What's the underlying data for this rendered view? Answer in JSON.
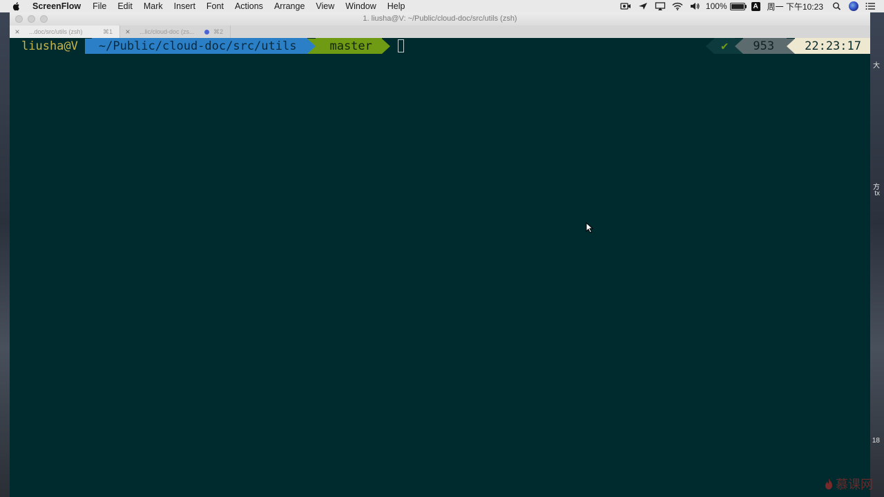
{
  "menubar": {
    "app_name": "ScreenFlow",
    "items": [
      "File",
      "Edit",
      "Mark",
      "Insert",
      "Font",
      "Actions",
      "Arrange",
      "View",
      "Window",
      "Help"
    ],
    "status_icons": [
      "screenflow-record-icon",
      "location-icon",
      "airplay-icon",
      "wifi-icon",
      "volume-icon"
    ],
    "battery_text": "100%",
    "battery_level": 1.0,
    "input_source": "A",
    "datetime": "周一 下午10:23"
  },
  "window": {
    "title": "1. liusha@V: ~/Public/cloud-doc/src/utils (zsh)",
    "tabs": [
      {
        "label": "...doc/src/utils (zsh)",
        "shortcut": "⌘1"
      },
      {
        "label": "...lic/cloud-doc (zs...",
        "shortcut": "⌘2"
      }
    ]
  },
  "prompt": {
    "user_host": "liusha@V",
    "cwd": "~/Public/cloud-doc/src/utils",
    "branch_icon": "",
    "branch": "master",
    "status_symbol": "✔",
    "history_number": "953",
    "time": "22:23:17"
  },
  "edge_text": {
    "top": "大",
    "mid_1": "方",
    "mid_2": "tx",
    "bottom": "18"
  },
  "watermark": "慕课网",
  "colors": {
    "terminal_bg": "#002b2e",
    "dir_segment": "#2a7fc7",
    "git_segment": "#6f9a14",
    "user_text": "#c9b64a",
    "clock_segment": "#eee8d0"
  }
}
